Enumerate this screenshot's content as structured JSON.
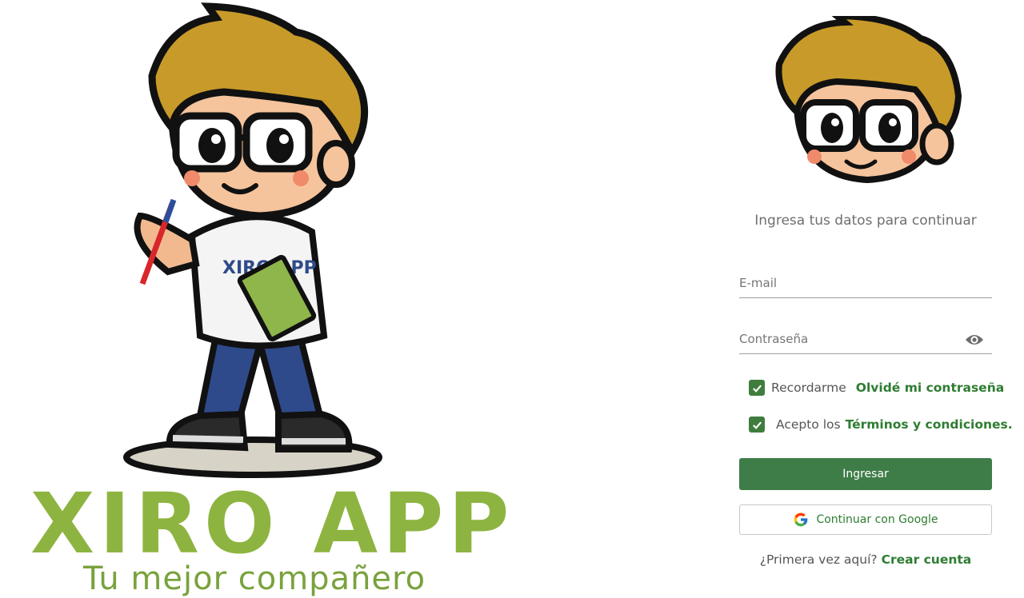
{
  "brand": {
    "title": "XIRO APP",
    "tagline": "Tu mejor compañero",
    "shirt_text": "XIRO APP",
    "primary_color": "#8db440"
  },
  "login": {
    "subtitle": "Ingresa tus datos para continuar",
    "email_placeholder": "E-mail",
    "password_placeholder": "Contraseña",
    "remember_label": "Recordarme",
    "remember_checked": true,
    "forgot_link": "Olvidé mi contraseña",
    "accept_prefix": "Acepto los",
    "terms_link": "Términos y condiciones.",
    "terms_checked": true,
    "submit_label": "Ingresar",
    "google_label": "Continuar con Google",
    "signup_prompt": "¿Primera vez aquí?",
    "signup_link": "Crear cuenta",
    "accent_color": "#3f7d48"
  }
}
